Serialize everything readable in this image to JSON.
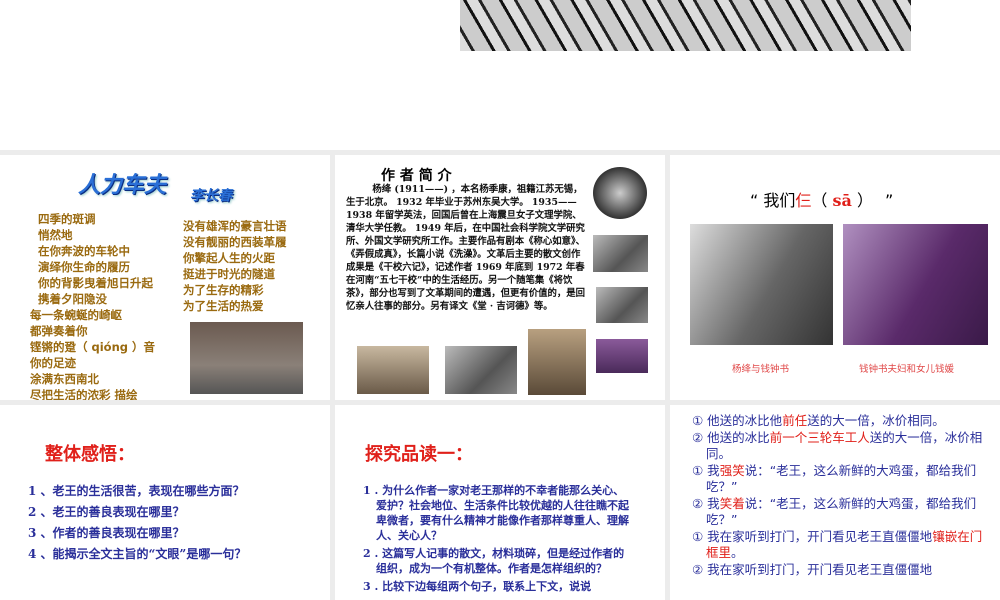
{
  "slide1": {
    "title": "人力车夫",
    "author": "李长春",
    "col_left": [
      "四季的斑调",
      "悄然地",
      "在你奔波的车轮中",
      "演绎你生命的履历",
      "你的背影曳着旭日升起",
      "携着夕阳隐没"
    ],
    "col_left2": [
      "每一条蜿蜒的崎岖",
      "都弹奏着你",
      "铿锵的跫（ qióng ）音",
      "你的足迹",
      "涂满东西南北",
      "尽把生活的浓彩 描绘"
    ],
    "col_right": [
      "没有雄浑的豪言壮语",
      "没有靓丽的西装革履",
      "你擎起人生的火距",
      "挺进于时光的隧道",
      "为了生存的精彩",
      "为了生活的热爱"
    ]
  },
  "slide2": {
    "title": "作 者 简 介",
    "bio": "杨绛 (1911——) ，本名杨季康，祖籍江苏无锡，生于北京。 1932 年毕业于苏州东吴大学。 1935——1938 年留学英法，回国后曾在上海震旦女子文理学院、清华大学任教。 1949 年后，在中国社会科学院文学研究所、外国文学研究所工作。主要作品有剧本《称心如意》、《弄假成真》，长篇小说《洗澡》。文革后主要的散文创作成果是《干校六记》，记述作者 1969 年底到 1972 年春在河南“五七干校”中的生活经历。另一个随笔集《将饮茶》，部分也写到了文革期间的遭遇，但更有价值的，是回忆亲人往事的部分。另有译文《堂 · 吉诃德》等。"
  },
  "slide3": {
    "q_open": "“ 我们",
    "q_char": "仨",
    "q_pinyin_open": "（ ",
    "q_pinyin": "sā",
    "q_pinyin_close": " ）",
    "q_close": "”",
    "caption1": "杨绛与钱钟书",
    "caption2": "钱钟书夫妇和女儿钱媛"
  },
  "slide4": {
    "title": "整体感悟：",
    "items": [
      "1 、老王的生活很苦，表现在哪些方面？",
      "2 、老王的善良表现在哪里？",
      "3 、作者的善良表现在哪里？",
      "4 、能揭示全文主旨的“文眼”是哪一句？"
    ]
  },
  "slide5": {
    "title": "探究品读一：",
    "items": [
      "1 . 为什么作者一家对老王那样的不幸者能那么关心、爱护？社会地位、生活条件比较优越的人往往瞧不起卑微者，要有什么精神才能像作者那样尊重人、理解人、关心人？",
      "2 . 这篇写人记事的散文，材料琐碎，但是经过作者的组织，成为一个有机整体。作者是怎样组织的？",
      "3 . 比较下边每组两个句子，联系上下文，说说"
    ]
  },
  "slide6": {
    "lines": [
      {
        "a": "① 他送的冰比他",
        "r": "前任",
        "b": "送的大一倍，冰价相同。"
      },
      {
        "a": "② 他送的冰比",
        "r": "前一个三轮车工人",
        "b": "送的大一倍，冰价相同。"
      },
      {
        "a": "① 我",
        "r": "强笑",
        "b": "说：“老王，这么新鲜的大鸡蛋，都给我们吃？”"
      },
      {
        "a": "② 我",
        "r": "笑着",
        "b": "说：“老王，这么新鲜的大鸡蛋，都给我们吃？”"
      },
      {
        "a": "① 我在家听到打门，开门看见老王直僵僵地",
        "r": "镶嵌在门框里",
        "b": "。"
      },
      {
        "a": "② 我在家听到打门，开门看见老王直僵僵地",
        "r": "",
        "b": ""
      }
    ]
  }
}
